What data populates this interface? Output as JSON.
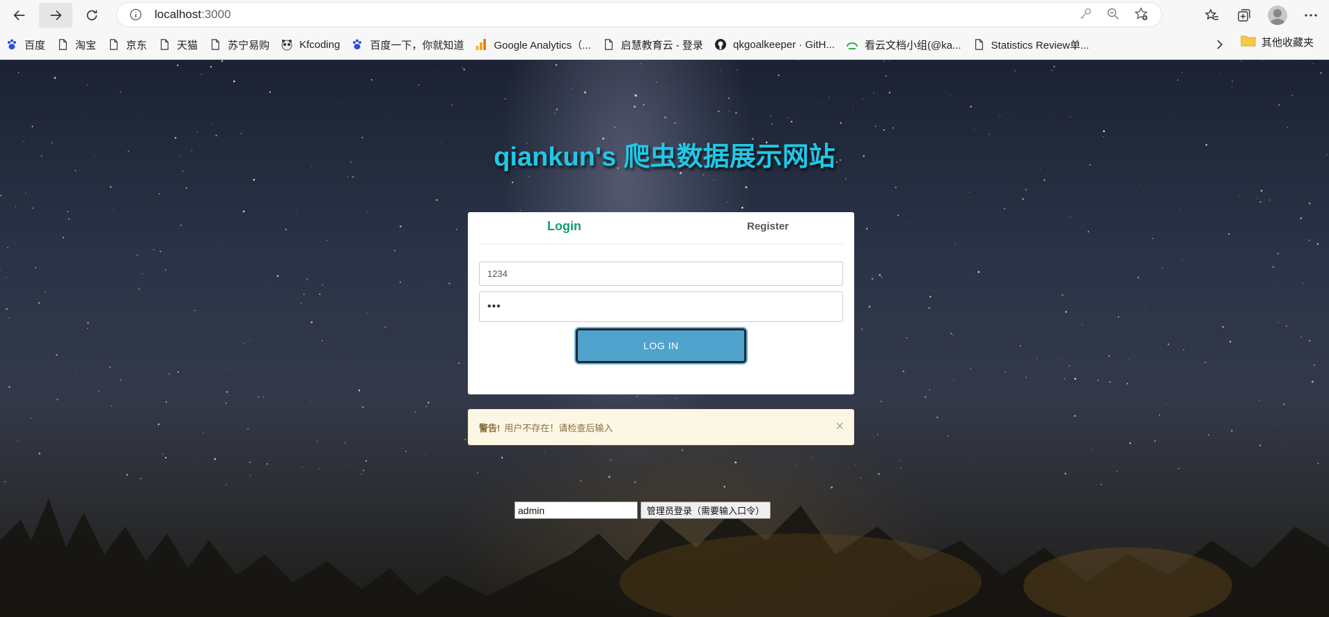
{
  "browser": {
    "url_host": "localhost",
    "url_port": ":3000",
    "bookmarks": [
      {
        "label": "百度",
        "icon": "baidu-paw-icon"
      },
      {
        "label": "淘宝",
        "icon": "page-icon"
      },
      {
        "label": "京东",
        "icon": "page-icon"
      },
      {
        "label": "天猫",
        "icon": "page-icon"
      },
      {
        "label": "苏宁易购",
        "icon": "page-icon"
      },
      {
        "label": "Kfcoding",
        "icon": "panda-icon"
      },
      {
        "label": "百度一下，你就知道",
        "icon": "baidu-paw-icon"
      },
      {
        "label": "Google Analytics（...",
        "icon": "analytics-icon"
      },
      {
        "label": "启慧教育云 - 登录",
        "icon": "page-icon"
      },
      {
        "label": "qkgoalkeeper · GitH...",
        "icon": "github-icon"
      },
      {
        "label": "看云文档小组(@ka...",
        "icon": "kancloud-icon"
      },
      {
        "label": "Statistics Review单...",
        "icon": "page-icon"
      }
    ],
    "other_bookmarks": "其他收藏夹"
  },
  "page": {
    "title": "qiankun's 爬虫数据展示网站",
    "tabs": {
      "login": "Login",
      "register": "Register"
    },
    "username_value": "1234",
    "password_value": "•••",
    "login_button": "LOG IN",
    "alert": {
      "strong": "警告!",
      "message": "用户不存在！请检查后输入",
      "close": "×"
    },
    "admin": {
      "input_value": "admin",
      "button": "管理员登录（需要输入口令）"
    }
  },
  "colors": {
    "title": "#20c8e6",
    "login_tab": "#14a06a",
    "login_button": "#4fa3cd",
    "alert_bg": "#fcf7e4",
    "alert_text": "#8a6d3b"
  }
}
